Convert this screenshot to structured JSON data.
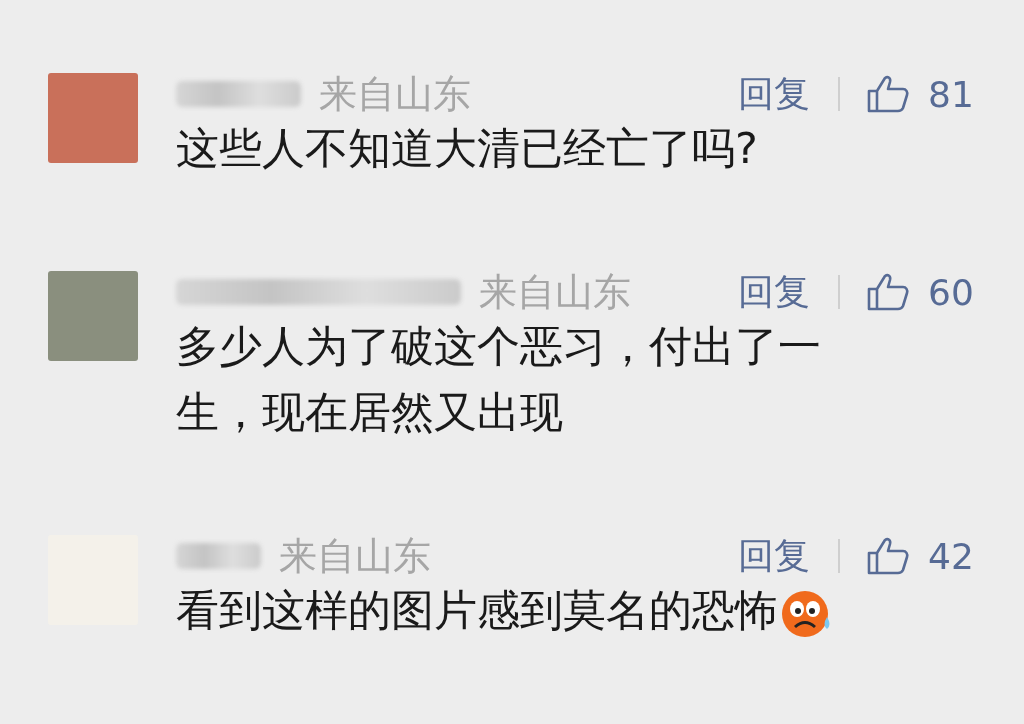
{
  "comments": [
    {
      "location": "来自山东",
      "reply": "回复",
      "likes": "81",
      "text": "这些人不知道大清已经亡了吗?",
      "emoji": false
    },
    {
      "location": "来自山东",
      "reply": "回复",
      "likes": "60",
      "text": "多少人为了破这个恶习，付出了一生，现在居然又出现",
      "emoji": false
    },
    {
      "location": "来自山东",
      "reply": "回复",
      "likes": "42",
      "text": "看到这样的图片感到莫名的恐怖",
      "emoji": true
    }
  ]
}
